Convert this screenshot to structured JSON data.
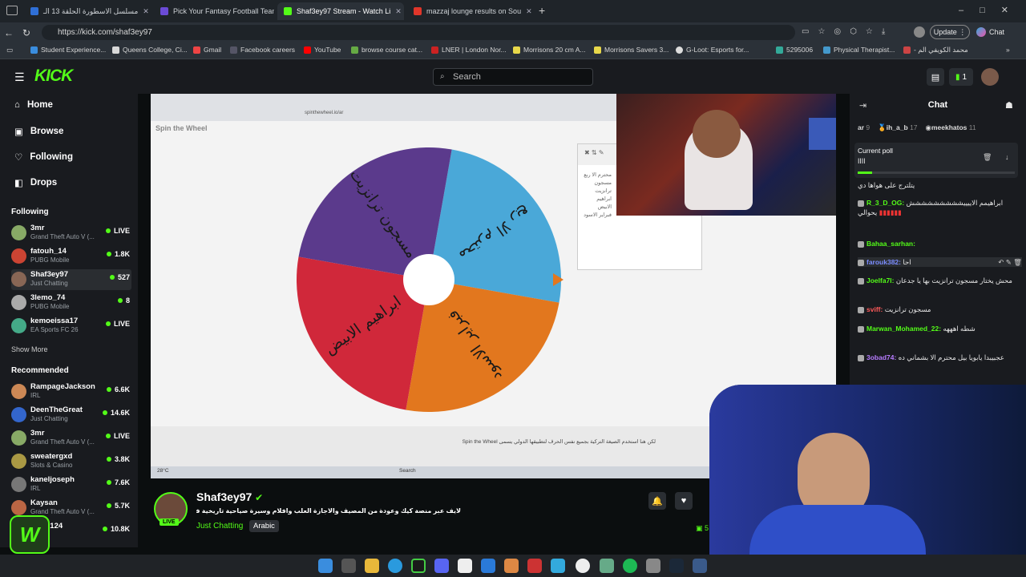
{
  "browser": {
    "tabs": [
      {
        "label": "مسلسل الاسطورة الحلقة 13 الـ",
        "color": "#2f6fd6"
      },
      {
        "label": "Pick Your Fantasy Football Team |",
        "color": "#6b4bd6"
      },
      {
        "label": "Shaf3ey97 Stream - Watch Li",
        "color": "#53fc18"
      },
      {
        "label": "mazzaj lounge results on Sou",
        "color": "#e0362a"
      }
    ],
    "url": "https://kick.com/shaf3ey97",
    "update_label": "Update",
    "chat_ext_label": "Chat",
    "bookmarks": [
      {
        "label": "Student Experience...",
        "color": "#3a8dde"
      },
      {
        "label": "Queens College, Ci...",
        "color": "#d8d8d8"
      },
      {
        "label": "Gmail",
        "color": "#e44"
      },
      {
        "label": "Facebook careers",
        "color": "#556"
      },
      {
        "label": "YouTube",
        "color": "#f00"
      },
      {
        "label": "browse course cat...",
        "color": "#6a4"
      },
      {
        "label": "LNER | London Nor...",
        "color": "#c22"
      },
      {
        "label": "Morrisons 20 cm A...",
        "color": "#e8d84a"
      },
      {
        "label": "Morrisons Savers 3...",
        "color": "#e8d84a"
      },
      {
        "label": "G-Loot: Esports for...",
        "color": "#ddd"
      },
      {
        "label": "5295006",
        "color": "#3a9"
      },
      {
        "label": "Physical Therapist...",
        "color": "#49c"
      },
      {
        "label": "- محمد الكويفي الم",
        "color": "#c44"
      }
    ]
  },
  "kick": {
    "logo": "KICK",
    "search_placeholder": "Search",
    "notif_count": "1",
    "nav": {
      "home": "Home",
      "browse": "Browse",
      "following": "Following",
      "drops": "Drops"
    },
    "following_title": "Following",
    "following": [
      {
        "name": "3mr",
        "game": "Grand Theft Auto V (...",
        "viewers": "LIVE",
        "color": "#8a6"
      },
      {
        "name": "fatouh_14",
        "game": "PUBG Mobile",
        "viewers": "1.8K",
        "color": "#c43"
      },
      {
        "name": "Shaf3ey97",
        "game": "Just Chatting",
        "viewers": "527",
        "color": "#865"
      },
      {
        "name": "3lemo_74",
        "game": "PUBG Mobile",
        "viewers": "8",
        "color": "#aaa"
      },
      {
        "name": "kemoeissa17",
        "game": "EA Sports FC 26",
        "viewers": "LIVE",
        "color": "#4a8"
      }
    ],
    "show_more": "Show More",
    "recommended_title": "Recommended",
    "recommended": [
      {
        "name": "RampageJackson",
        "game": "IRL",
        "viewers": "6.6K",
        "color": "#c85"
      },
      {
        "name": "DeenTheGreat",
        "game": "Just Chatting",
        "viewers": "14.6K",
        "color": "#36c"
      },
      {
        "name": "3mr",
        "game": "Grand Theft Auto V (...",
        "viewers": "LIVE",
        "color": "#8a6"
      },
      {
        "name": "sweatergxd",
        "game": "Slots & Casino",
        "viewers": "3.8K",
        "color": "#a94"
      },
      {
        "name": "kaneljoseph",
        "game": "IRL",
        "viewers": "7.6K",
        "color": "#777"
      },
      {
        "name": "Kaysan",
        "game": "Grand Theft Auto V (...",
        "viewers": "5.7K",
        "color": "#b64"
      },
      {
        "name": "clues124",
        "game": "",
        "viewers": "10.8K",
        "color": "#2a8"
      }
    ]
  },
  "stream": {
    "wheel_title": "Spin the Wheel",
    "wheel_url": "spinthewheel.io/ar",
    "segments": [
      {
        "label": "محترم الا ربع",
        "color": "#4aa8d8"
      },
      {
        "label": "فبراير الاسود",
        "color": "#e2771e"
      },
      {
        "label": "ابراهيم الابيض",
        "color": "#d0283a"
      },
      {
        "label": "مسجون ترانزيت",
        "color": "#5b3a8c"
      }
    ],
    "entries": [
      "محترم الا ربع",
      "مسجون ترانزيت",
      "ابراهيم الابيض",
      "فبراير الاسود"
    ],
    "footer_note": "لكن هنا استخدم الصيغة التركية بجميع نفس الحرف لتطبيقها الدولي يسمى Spin the Wheel",
    "weather": "28°C",
    "taskbar_search": "Search"
  },
  "channel": {
    "name": "Shaf3ey97",
    "live": "LIVE",
    "title": "لايف عبر منصة كيك وعودة من المصيف والاجازة العلب وافلام وسيرة صياحية تاريخية فحوانية",
    "category": "Just Chatting",
    "tag": "Arabic",
    "viewers": "5"
  },
  "chat": {
    "title": "Chat",
    "top": [
      {
        "name": "ar",
        "n": "9"
      },
      {
        "name": "ih_a_b",
        "n": "17"
      },
      {
        "name": "meekhatos",
        "n": "11"
      }
    ],
    "poll_label": "Current poll",
    "poll_text": "اااا",
    "messages": [
      {
        "user": "",
        "text": "يتلترج على هواها دي",
        "color": "#fff"
      },
      {
        "user": "R_3_D_OG:",
        "text": "ابراهيمم الاييييششششششششش يحوالي",
        "color": "#53fc18"
      },
      {
        "user": "Bahaa_sarhan:",
        "text": "",
        "color": "#53fc18"
      },
      {
        "user": "farouk382:",
        "text": "احا",
        "color": "#7b8cff"
      },
      {
        "user": "Joelfa7l:",
        "text": "محش يختار مسجون ترانزيت بها يا جدعان",
        "color": "#53fc18"
      },
      {
        "user": "sviff:",
        "text": "مسجون ترانزيت",
        "color": "#ff5a5a"
      },
      {
        "user": "Marwan_Mohamed_22:",
        "text": "شطه اهههه",
        "color": "#53fc18"
      },
      {
        "user": "3obad74:",
        "text": "عجبيبدا يابويا بيل محترم الا بشماني ده",
        "color": "#b77cff"
      }
    ]
  }
}
